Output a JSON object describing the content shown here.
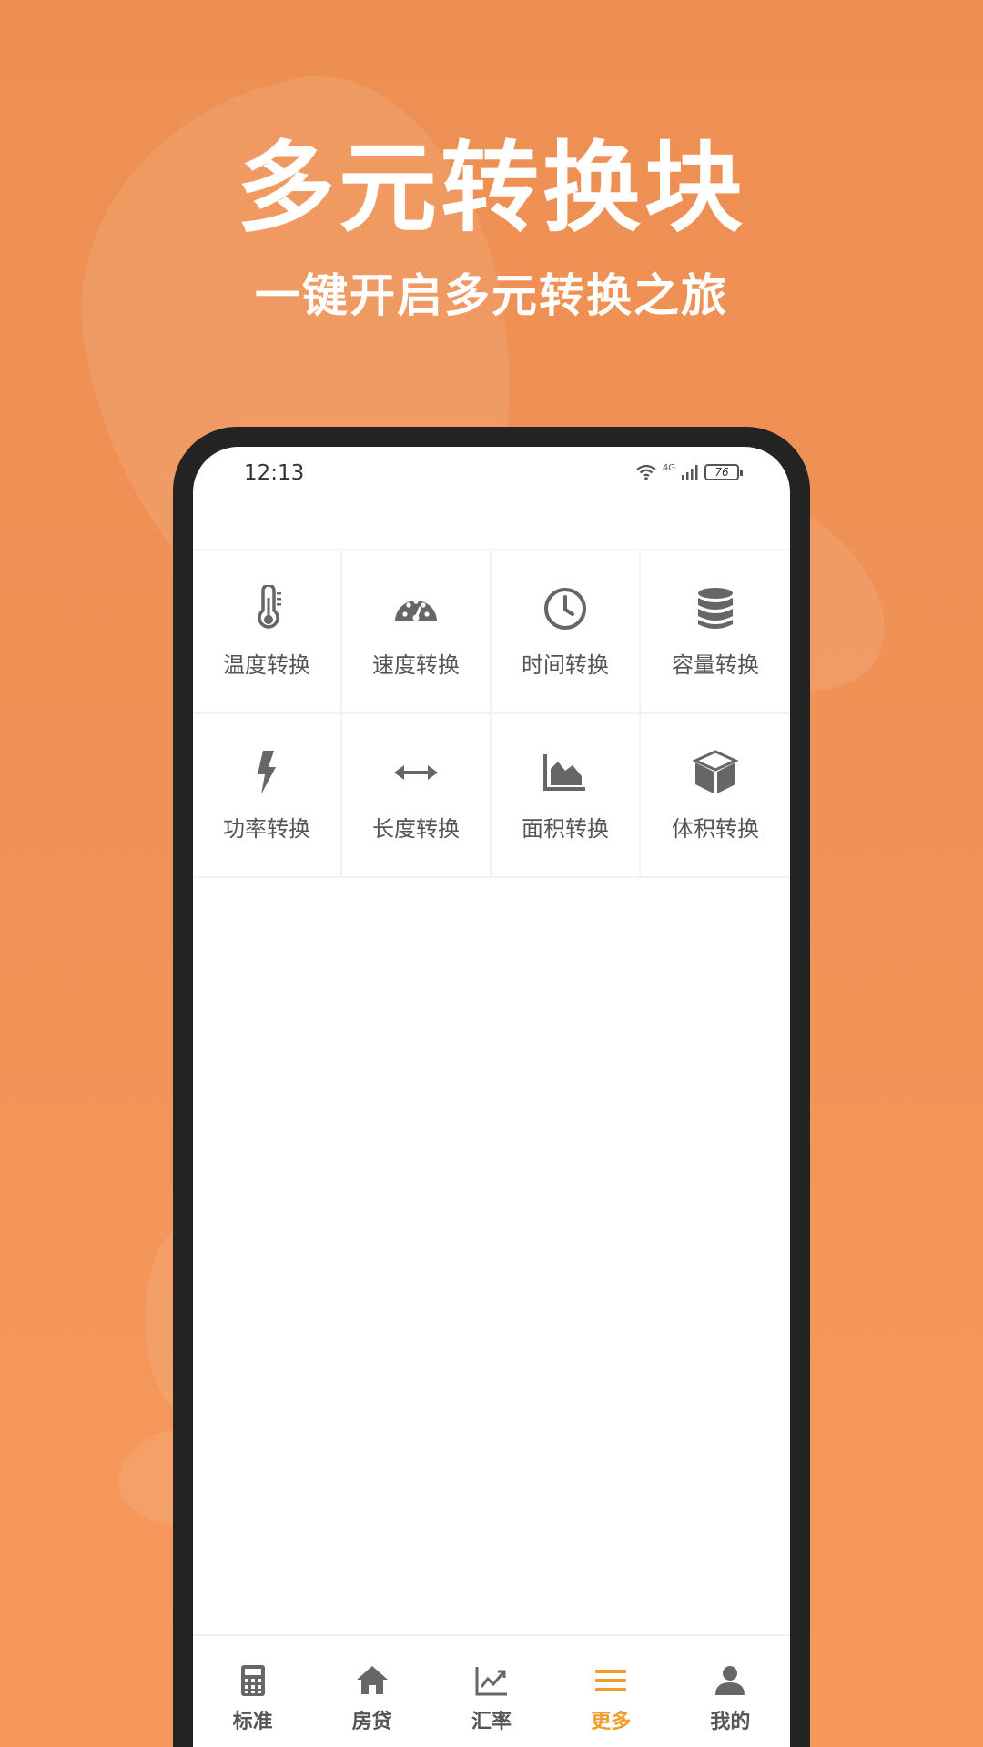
{
  "promo": {
    "headline": "多元转换块",
    "subheadline": "一键开启多元转换之旅"
  },
  "status_bar": {
    "time": "12:13",
    "network": "4G",
    "battery": "76"
  },
  "converters": [
    {
      "label": "温度转换",
      "icon": "thermometer-icon"
    },
    {
      "label": "速度转换",
      "icon": "speedometer-icon"
    },
    {
      "label": "时间转换",
      "icon": "clock-icon"
    },
    {
      "label": "容量转换",
      "icon": "database-icon"
    },
    {
      "label": "功率转换",
      "icon": "lightning-bolt-icon"
    },
    {
      "label": "长度转换",
      "icon": "double-arrow-icon"
    },
    {
      "label": "面积转换",
      "icon": "area-chart-icon"
    },
    {
      "label": "体积转换",
      "icon": "cube-icon"
    }
  ],
  "tabbar": {
    "active_tab": "更多",
    "tabs": [
      {
        "label": "标准",
        "icon": "calculator-icon"
      },
      {
        "label": "房贷",
        "icon": "home-icon"
      },
      {
        "label": "汇率",
        "icon": "line-chart-icon"
      },
      {
        "label": "更多",
        "icon": "menu-icon"
      },
      {
        "label": "我的",
        "icon": "user-icon"
      }
    ]
  },
  "colors": {
    "background": "#ef9155",
    "accent": "#f19b2b",
    "icon": "#666666",
    "text": "#555555"
  }
}
